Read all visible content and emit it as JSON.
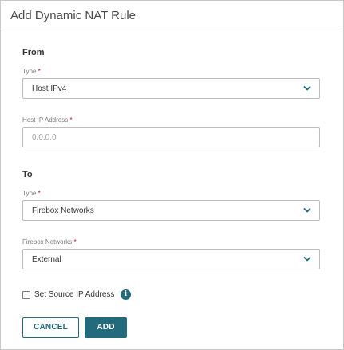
{
  "dialog": {
    "title": "Add Dynamic NAT Rule"
  },
  "from": {
    "heading": "From",
    "type_label": "Type",
    "type_value": "Host IPv4",
    "host_ip_label": "Host IP Address",
    "host_ip_placeholder": "0.0.0.0",
    "host_ip_value": ""
  },
  "to": {
    "heading": "To",
    "type_label": "Type",
    "type_value": "Firebox Networks",
    "networks_label": "Firebox Networks",
    "networks_value": "External"
  },
  "options": {
    "set_source_ip_label": "Set Source IP Address",
    "set_source_ip_checked": false,
    "info_icon": "info-icon"
  },
  "buttons": {
    "cancel_label": "CANCEL",
    "add_label": "ADD"
  },
  "required_marker": "*",
  "colors": {
    "accent": "#236b7c",
    "required": "#d0021b",
    "border": "#bdbdbd"
  }
}
